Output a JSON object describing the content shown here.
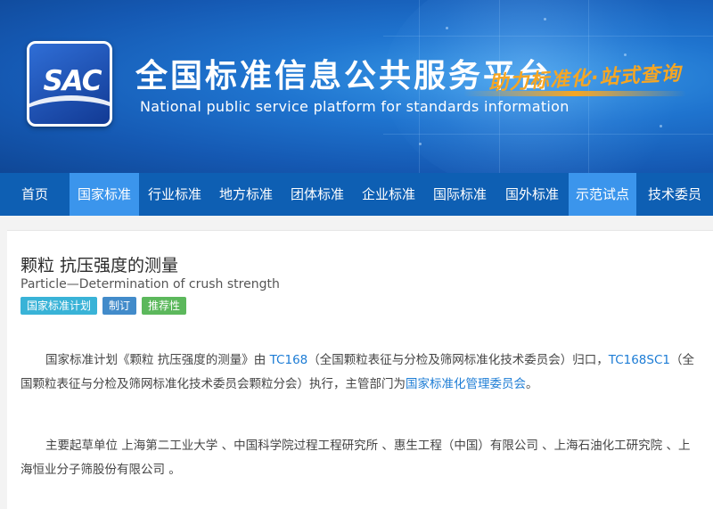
{
  "header": {
    "logo_text": "SAC",
    "title_cn": "全国标准信息公共服务平台",
    "title_en": "National public service platform  for standards information",
    "slogan": "助力标准化·站式查询"
  },
  "nav": {
    "items": [
      {
        "label": "首页",
        "active": false
      },
      {
        "label": "国家标准",
        "active": true
      },
      {
        "label": "行业标准",
        "active": false
      },
      {
        "label": "地方标准",
        "active": false
      },
      {
        "label": "团体标准",
        "active": false
      },
      {
        "label": "企业标准",
        "active": false
      },
      {
        "label": "国际标准",
        "active": false
      },
      {
        "label": "国外标准",
        "active": false
      },
      {
        "label": "示范试点",
        "active": true
      },
      {
        "label": "技术委员",
        "active": false
      }
    ]
  },
  "standard": {
    "title_cn": "颗粒 抗压强度的测量",
    "title_en": "Particle—Determination of crush strength",
    "tags": [
      "国家标准计划",
      "制订",
      "推荐性"
    ],
    "para1": {
      "t1": "国家标准计划《颗粒 抗压强度的测量》由 ",
      "link1": "TC168",
      "t2": "（全国颗粒表征与分检及筛网标准化技术委员会）归口，",
      "link2": "TC168SC1",
      "t3": "（全国颗粒表征与分检及筛网标准化技术委员会颗粒分会）执行，主管部门为",
      "link3": "国家标准化管理委员会",
      "t4": "。"
    },
    "para2": "主要起草单位 上海第二工业大学 、中国科学院过程工程研究所 、惠生工程（中国）有限公司 、上海石油化工研究院 、上海恒业分子筛股份有限公司 。"
  },
  "colors": {
    "nav_bg": "#0e5fb3",
    "nav_active": "#3b95ec",
    "link": "#1c7cd5",
    "tag_plan": "#39b3d7",
    "tag_revise": "#428bca",
    "tag_recommend": "#5cb85c",
    "slogan": "#f6a623"
  }
}
